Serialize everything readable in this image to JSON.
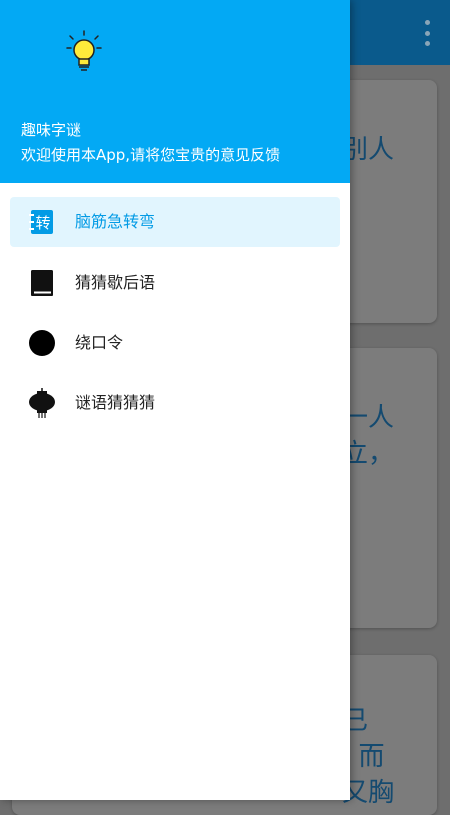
{
  "background": {
    "card1_text": "别人",
    "card2_text": "一人\n立，",
    "card3_text": "已\n  而\n又胸"
  },
  "drawer": {
    "header": {
      "app_name": "趣味字谜",
      "subtitle": "欢迎使用本App,请将您宝贵的意见反馈",
      "icon": "lightbulb-icon"
    },
    "menu": [
      {
        "label": "脑筋急转弯",
        "icon": "zhuan-icon",
        "icon_text": "转",
        "active": true
      },
      {
        "label": "猜猜歇后语",
        "icon": "book-icon",
        "active": false
      },
      {
        "label": "绕口令",
        "icon": "circle-icon",
        "active": false
      },
      {
        "label": "谜语猜猜猜",
        "icon": "lantern-icon",
        "active": false
      }
    ]
  },
  "colors": {
    "header_bg": "#03a9f4",
    "active_bg": "#e1f5fe",
    "active_text": "#039be5"
  }
}
